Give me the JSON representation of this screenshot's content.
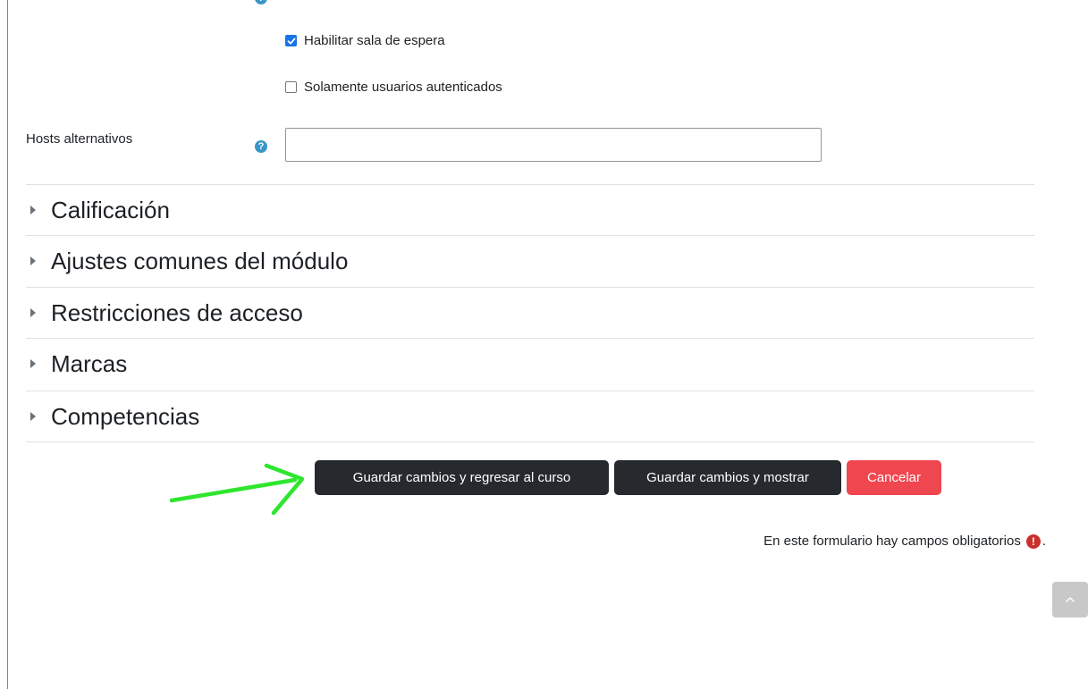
{
  "waiting_room": {
    "enable_label": "Habilitar sala de espera",
    "enable_checked": true,
    "authenticated_label": "Solamente usuarios autenticados",
    "authenticated_checked": false
  },
  "alt_hosts": {
    "label": "Hosts alternativos",
    "value": ""
  },
  "sections": [
    {
      "title": "Calificación"
    },
    {
      "title": "Ajustes comunes del módulo"
    },
    {
      "title": "Restricciones de acceso"
    },
    {
      "title": "Marcas"
    },
    {
      "title": "Competencias"
    }
  ],
  "buttons": {
    "save_return": "Guardar cambios y regresar al curso",
    "save_display": "Guardar cambios y mostrar",
    "cancel": "Cancelar"
  },
  "required_note": "En este formulario hay campos obligatorios",
  "required_note_suffix": ".",
  "annotation": {
    "arrow_color": "#2ee62e"
  },
  "colors": {
    "accent": "#3a96c8",
    "danger": "#f0464f",
    "dark_button": "#262a2e"
  }
}
